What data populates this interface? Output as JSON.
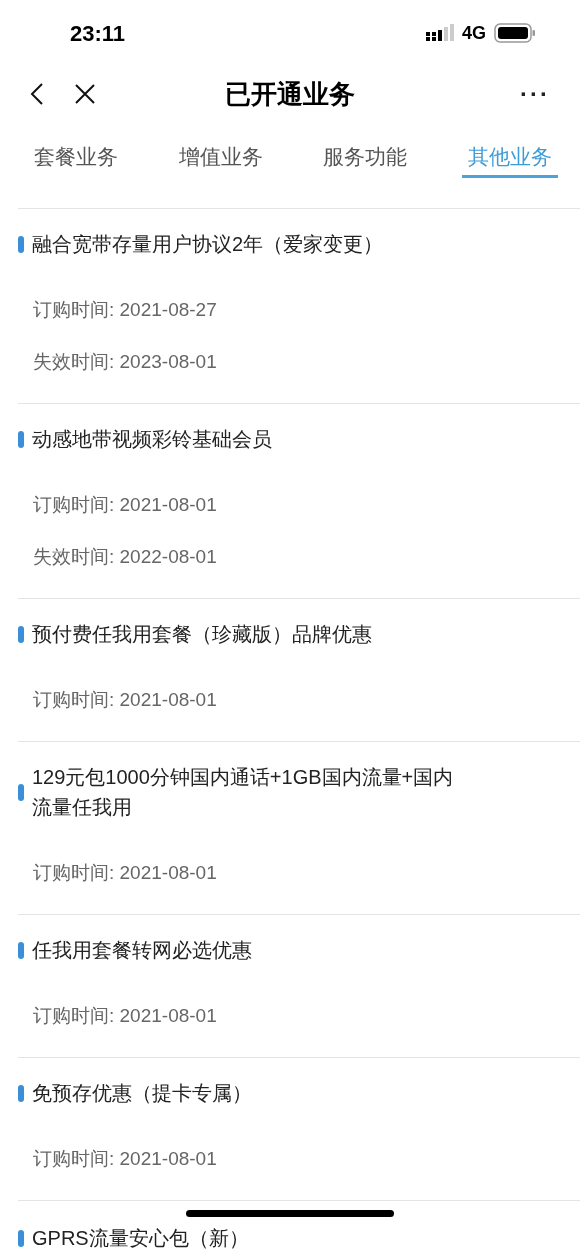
{
  "status_bar": {
    "time": "23:11",
    "network": "4G"
  },
  "nav": {
    "title": "已开通业务",
    "more": "···"
  },
  "tabs": [
    {
      "label": "套餐业务",
      "selected": false
    },
    {
      "label": "增值业务",
      "selected": false
    },
    {
      "label": "服务功能",
      "selected": false
    },
    {
      "label": "其他业务",
      "selected": true
    }
  ],
  "items": [
    {
      "title": "融合宽带存量用户协议2年（爱家变更）",
      "details": [
        "订购时间: 2021-08-27",
        "失效时间: 2023-08-01"
      ]
    },
    {
      "title": "动感地带视频彩铃基础会员",
      "details": [
        "订购时间: 2021-08-01",
        "失效时间: 2022-08-01"
      ]
    },
    {
      "title": "预付费任我用套餐（珍藏版）品牌优惠",
      "details": [
        "订购时间: 2021-08-01"
      ]
    },
    {
      "title": "129元包1000分钟国内通话+1GB国内流量+国内流量任我用",
      "details": [
        "订购时间: 2021-08-01"
      ]
    },
    {
      "title": "任我用套餐转网必选优惠",
      "details": [
        "订购时间: 2021-08-01"
      ]
    },
    {
      "title": "免预存优惠（提卡专属）",
      "details": [
        "订购时间: 2021-08-01"
      ]
    },
    {
      "title": "GPRS流量安心包（新）"
    }
  ]
}
